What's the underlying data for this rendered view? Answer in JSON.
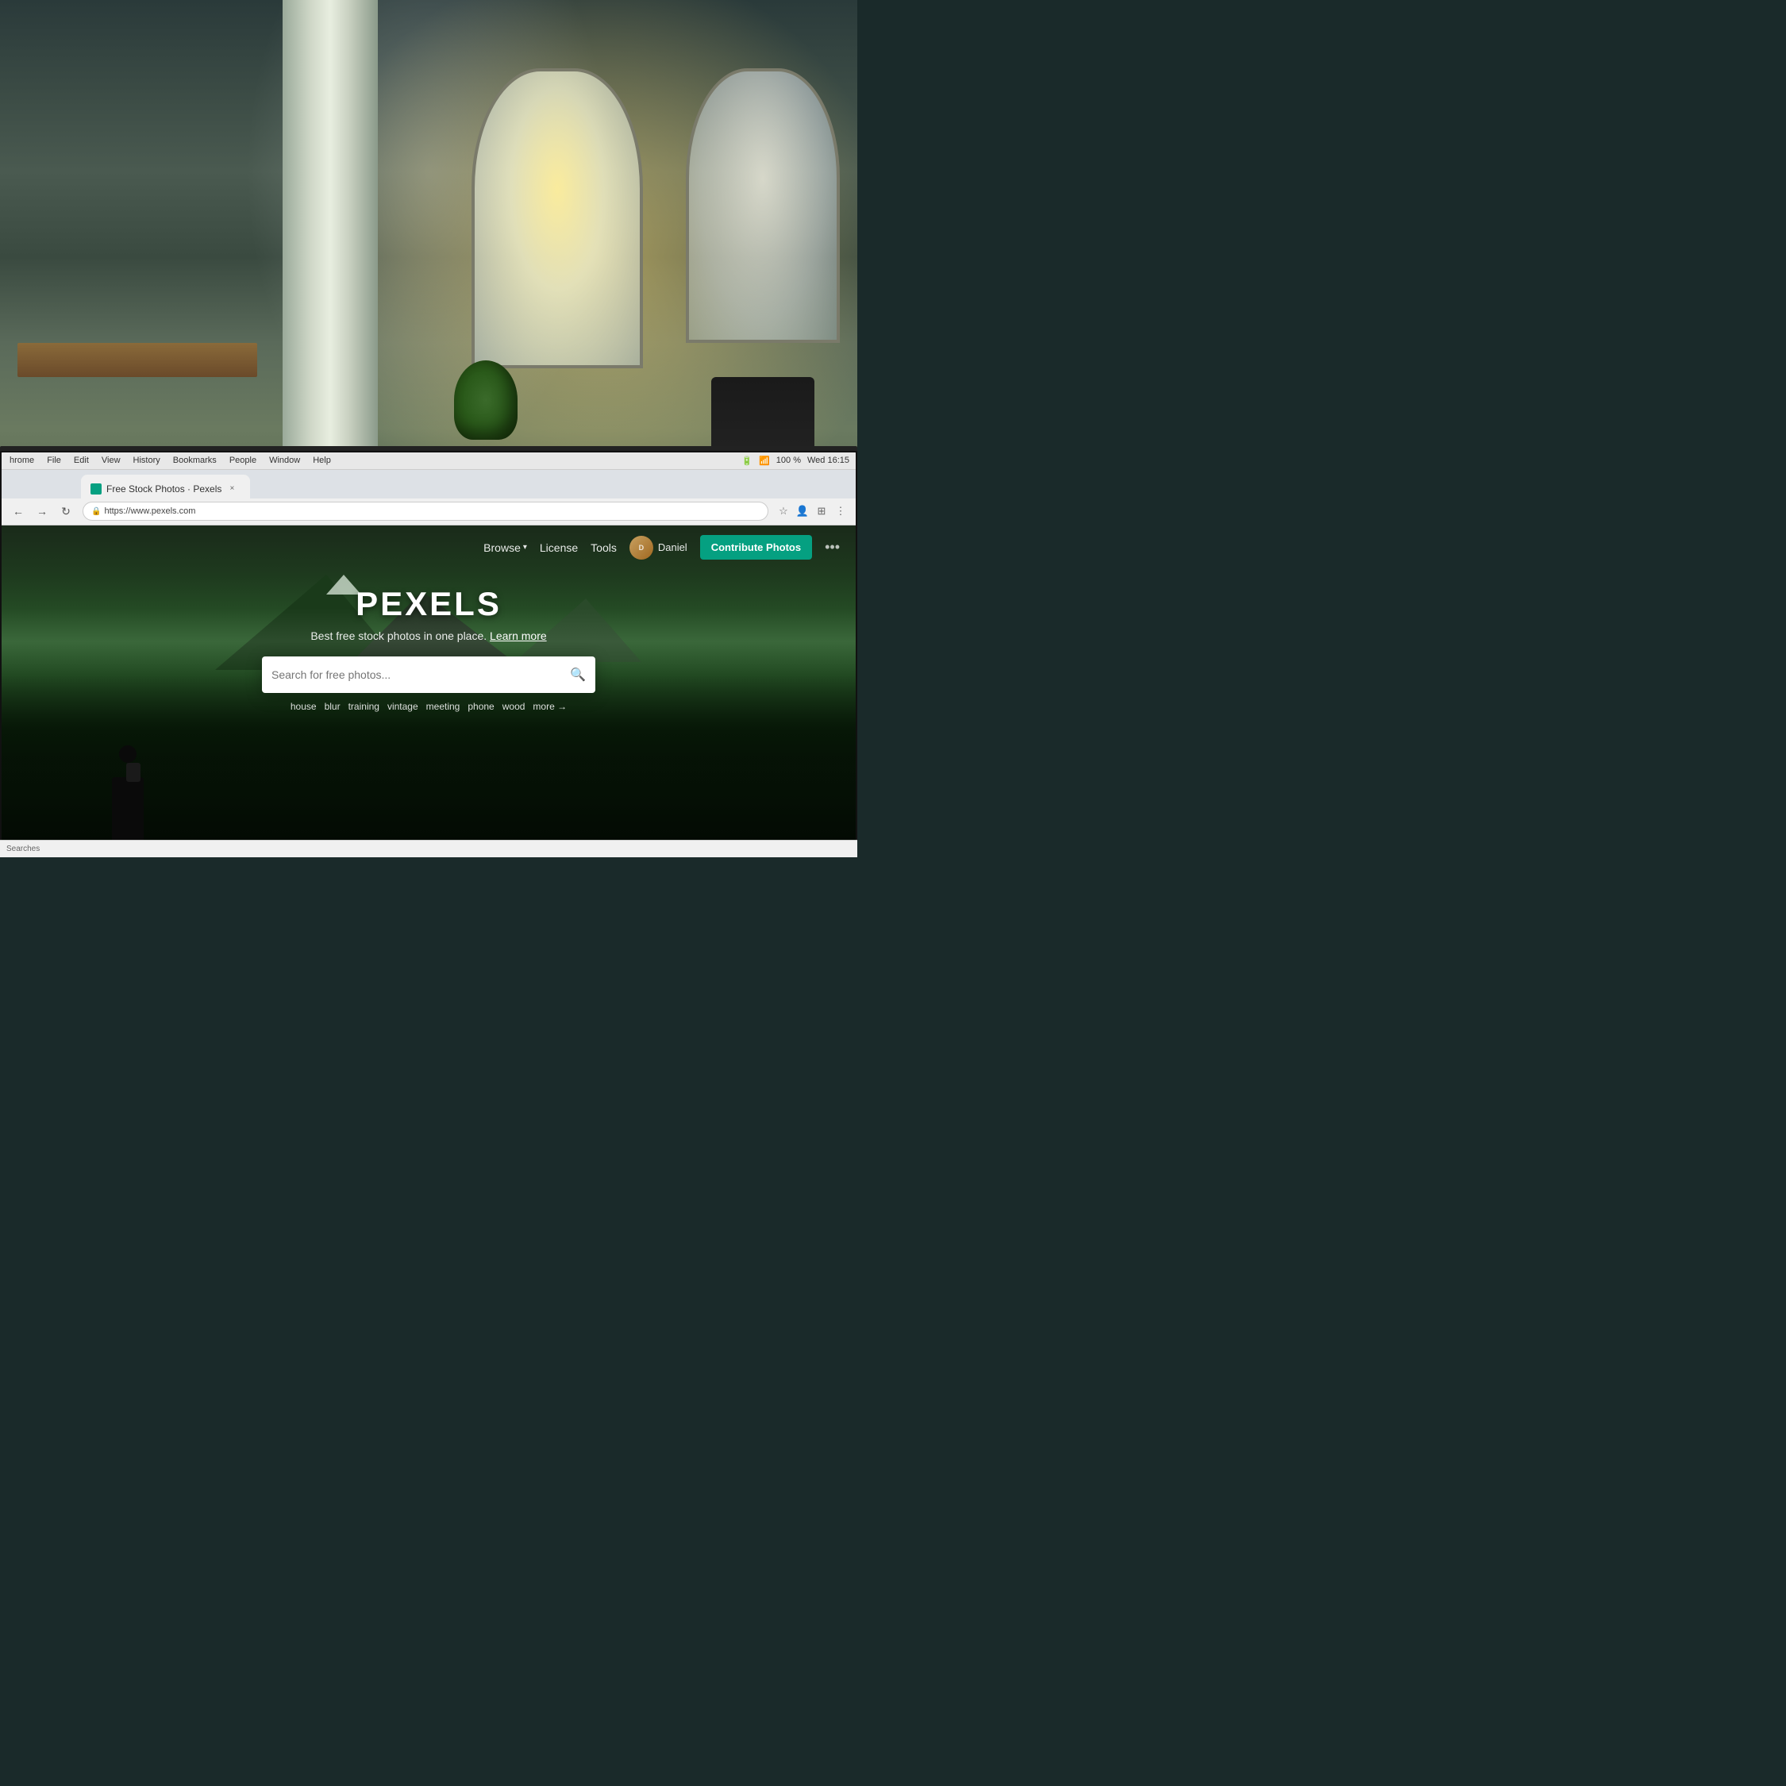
{
  "meta": {
    "dimensions": "1080x1080",
    "time": "Wed 16:15",
    "battery": "100 %"
  },
  "browser": {
    "tab_title": "Free Stock Photos · Pexels",
    "tab_close": "×",
    "url": "https://www.pexels.com",
    "secure_label": "Secure",
    "reload_icon": "↻",
    "back_icon": "←",
    "forward_icon": "→",
    "bookmark_icon": "☆",
    "extensions_icon": "⊞"
  },
  "menu_bar": {
    "app": "hrome",
    "items": [
      "File",
      "Edit",
      "View",
      "History",
      "Bookmarks",
      "People",
      "Window",
      "Help"
    ],
    "right_items": [
      "100 %",
      "Wed 16:15"
    ]
  },
  "address_bar": {
    "secure_text": "Secure",
    "url_text": "https://www.pexels.com"
  },
  "pexels": {
    "nav": {
      "browse_label": "Browse",
      "license_label": "License",
      "tools_label": "Tools",
      "user_name": "Daniel",
      "contribute_label": "Contribute Photos",
      "more_icon": "•••"
    },
    "hero": {
      "title": "PEXELS",
      "subtitle": "Best free stock photos in one place.",
      "learn_more": "Learn more",
      "search_placeholder": "Search for free photos...",
      "tags": [
        "house",
        "blur",
        "training",
        "vintage",
        "meeting",
        "phone",
        "wood",
        "more →"
      ]
    }
  },
  "bottom_bar": {
    "text": "Searches"
  }
}
